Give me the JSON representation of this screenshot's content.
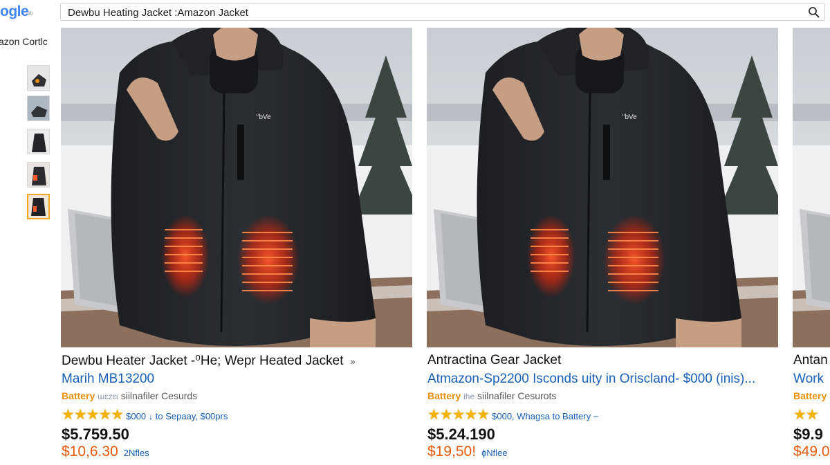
{
  "header": {
    "logo_text": "ogle",
    "logo_badge": "ttb",
    "search_value": "Dewbu Heating Jacket :Amazon Jacket"
  },
  "sidebar": {
    "title": "azon Cortlc",
    "thumbnails": [
      "thumb-1",
      "thumb-2",
      "thumb-3",
      "thumb-4",
      "thumb-5"
    ]
  },
  "results": [
    {
      "title": "Dewbu Heater Jacket -⁰He; Wepr Heated Jacket",
      "arrow": "»",
      "subtitle": "Marih MB13200",
      "tag_battery": "Battery",
      "tag_mid": "ɯɛzɛɩ",
      "tag_rest": "siilnafiler Cesurds",
      "stars": "★★★★★",
      "rating_meta": "$000 ↓ to Sepaay, $00prs",
      "price": "$5.759.50",
      "price2": "$10,6.30",
      "count": "2Nfles"
    },
    {
      "title": "Antractina Gear Jacket",
      "arrow": "",
      "subtitle": "Atmazon-Sp2200 Isconds uity in Oriscland- $000 (inis)...",
      "tag_battery": "Battery",
      "tag_mid": "ihe",
      "tag_rest": "siilnafiler Cesurots",
      "stars": "★★★★★",
      "rating_meta": "$000, Whagsa to Battery ~",
      "price": "$5.24.190",
      "price2": "$19,50!",
      "count": "ɸNflee"
    },
    {
      "title": "Antan",
      "arrow": "",
      "subtitle": "Work",
      "tag_battery": "Battery",
      "tag_mid": "",
      "tag_rest": "",
      "stars": "★★",
      "rating_meta": "",
      "price": "$9.9",
      "price2": "$49.0",
      "count": ""
    }
  ],
  "colors": {
    "link": "#1a5fb4",
    "star": "#f5b301",
    "price_alt": "#e8590c",
    "active_border": "#f5a623",
    "heat": "#ff3a1a"
  }
}
